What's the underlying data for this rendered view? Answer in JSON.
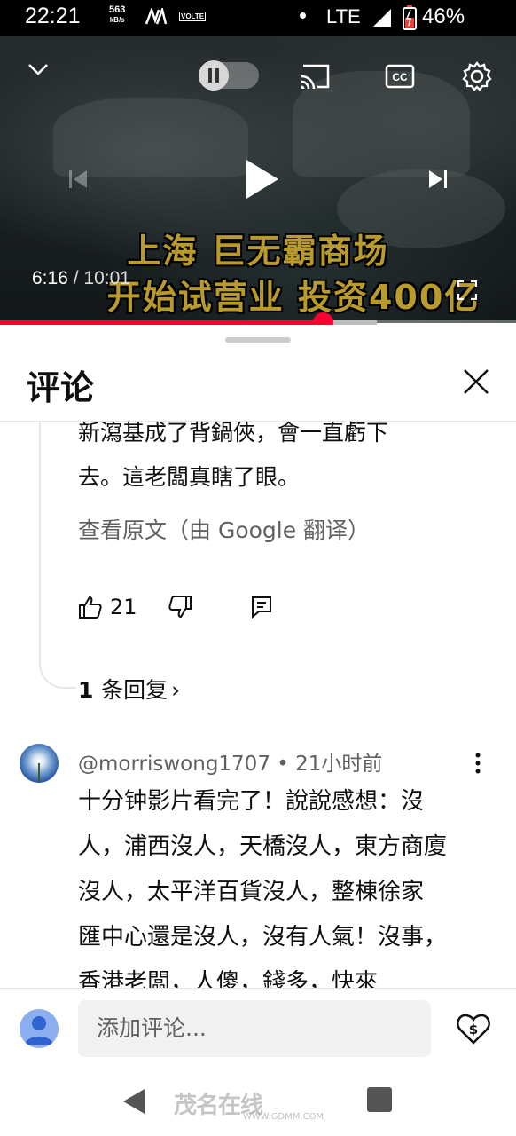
{
  "status_bar": {
    "time": "22:21",
    "net_speed_value": "563",
    "net_speed_unit": "kB/s",
    "volte": "VOLTE",
    "network": "LTE",
    "battery_pct": "46%"
  },
  "player": {
    "caption_line1": "上海 巨无霸商场",
    "caption_line2": "开始试营业 投资400亿",
    "time_current": "6:16",
    "time_separator": " / ",
    "time_total": "10:01",
    "progress_fraction": 0.625,
    "buffer_fraction": 0.73,
    "accent_color": "#ff0033"
  },
  "comments_panel": {
    "title": "评论",
    "first_comment": {
      "line1": "新瀉基成了背鍋俠，會一直虧下",
      "line2": "去。這老闆真瞎了眼。",
      "translate_link": "查看原文（由 Google 翻译）",
      "like_count": "21",
      "replies_count": "1",
      "replies_label": "条回复",
      "replies_chevron": "›"
    },
    "second_comment": {
      "author": "@morriswong1707",
      "separator": " • ",
      "time_ago": "21小时前",
      "lines": [
        "十分钟影片看完了！說說感想：沒",
        "人，浦西沒人，天橋沒人，東方商廈",
        "沒人，太平洋百貨沒人，整棟徐家",
        "匯中心還是沒人，沒有人氣！沒事，",
        "香港老闆，人傻，錢多，快來"
      ]
    }
  },
  "add_comment": {
    "placeholder": "添加评论..."
  },
  "watermark": {
    "text": "茂名在线",
    "url": "WWW.GDMM.COM"
  },
  "icons": {
    "collapse": "chevron-down-icon",
    "autoplay": "pause-icon",
    "cast": "cast-icon",
    "captions": "cc-icon",
    "settings": "gear-icon",
    "previous": "skip-previous-icon",
    "play": "play-icon",
    "next": "skip-next-icon",
    "fullscreen": "fullscreen-icon",
    "close": "close-icon",
    "like": "thumb-up-icon",
    "dislike": "thumb-down-icon",
    "reply": "reply-icon",
    "more": "more-vert-icon",
    "super_thanks": "heart-dollar-icon"
  }
}
